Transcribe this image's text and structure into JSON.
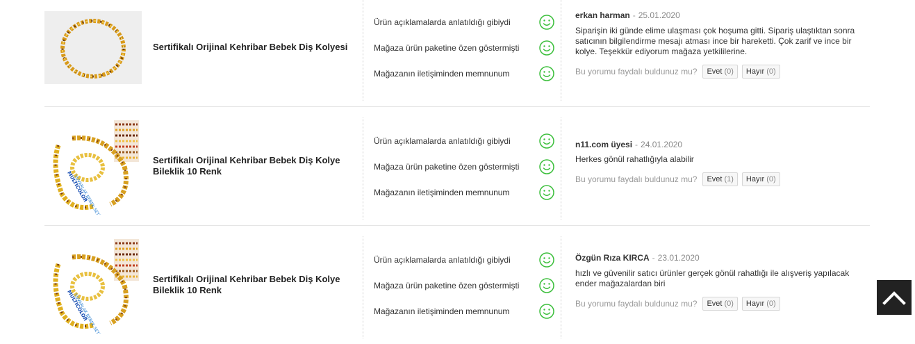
{
  "colors": {
    "smiley": "#3cbf3c",
    "scroll_top_bg": "#222222"
  },
  "reviews": [
    {
      "product": {
        "name": "Sertifikalı Orijinal Kehribar Bebek Diş Kolyesi",
        "image": "amber-necklace-thumbnail"
      },
      "ratings": [
        {
          "label": "Ürün açıklamalarda anlatıldığı gibiydi",
          "icon": "smiley-icon"
        },
        {
          "label": "Mağaza ürün paketine özen göstermişti",
          "icon": "smiley-icon"
        },
        {
          "label": "Mağazanın iletişiminden memnunum",
          "icon": "smiley-icon"
        }
      ],
      "author": "erkan harman",
      "separator": "-",
      "date": "25.01.2020",
      "text_lines": [
        "Siparişin iki günde elime ulaşması çok hoşuma gitti. Sipariş ulaştıktan sonra",
        "satıcının bilgilendirme mesajı atması ince bir hareketti. Çok zarif ve ince bir",
        "kolye. Teşekkür ediyorum mağaza yetkililerine."
      ],
      "helpful_question": "Bu yorumu faydalı buldunuz mu?",
      "yes_label": "Evet",
      "yes_count": "(0)",
      "no_label": "Hayır",
      "no_count": "(0)"
    },
    {
      "product": {
        "name_lines": [
          "Sertifikalı Orijinal Kehribar Bebek Diş Kolye",
          "Bileklik 10 Renk"
        ],
        "image": "amber-set-thumbnail",
        "image_text": "MULTICOLOR YUVARLAK BEBEK SETİ"
      },
      "ratings": [
        {
          "label": "Ürün açıklamalarda anlatıldığı gibiydi",
          "icon": "smiley-icon"
        },
        {
          "label": "Mağaza ürün paketine özen göstermişti",
          "icon": "smiley-icon"
        },
        {
          "label": "Mağazanın iletişiminden memnunum",
          "icon": "smiley-icon"
        }
      ],
      "author": "n11.com üyesi",
      "separator": "-",
      "date": "24.01.2020",
      "text_lines": [
        "Herkes gönül rahatlığıyla alabilir"
      ],
      "helpful_question": "Bu yorumu faydalı buldunuz mu?",
      "yes_label": "Evet",
      "yes_count": "(1)",
      "no_label": "Hayır",
      "no_count": "(0)"
    },
    {
      "product": {
        "name_lines": [
          "Sertifikalı Orijinal Kehribar Bebek Diş Kolye",
          "Bileklik 10 Renk"
        ],
        "image": "amber-set-thumbnail",
        "image_text": "MULTICOLOR YUVARLAK BEBEK SETİ"
      },
      "ratings": [
        {
          "label": "Ürün açıklamalarda anlatıldığı gibiydi",
          "icon": "smiley-icon"
        },
        {
          "label": "Mağaza ürün paketine özen göstermişti",
          "icon": "smiley-icon"
        },
        {
          "label": "Mağazanın iletişiminden memnunum",
          "icon": "smiley-icon"
        }
      ],
      "author": "Özgün Rıza KIRCA",
      "separator": "-",
      "date": "23.01.2020",
      "text_lines": [
        "hızlı ve güvenilir satıcı ürünler gerçek gönül rahatlığı ile alışveriş yapılacak",
        "ender mağazalardan biri"
      ],
      "helpful_question": "Bu yorumu faydalı buldunuz mu?",
      "yes_label": "Evet",
      "yes_count": "(0)",
      "no_label": "Hayır",
      "no_count": "(0)"
    }
  ],
  "scroll_top": {
    "icon": "chevron-up-icon"
  }
}
